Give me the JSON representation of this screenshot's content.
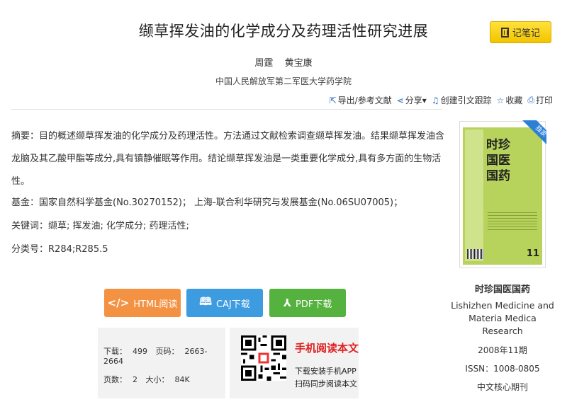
{
  "title": "缬草挥发油的化学成分及药理活性研究进展",
  "note_button": "记笔记",
  "authors": [
    "周霆",
    "黄宝康"
  ],
  "affiliation": "中国人民解放军第二军医大学药学院",
  "tools": [
    {
      "icon": "export-icon",
      "label": "导出/参考文献"
    },
    {
      "icon": "share-icon",
      "label": "分享▾"
    },
    {
      "icon": "bell-icon",
      "label": "创建引文跟踪"
    },
    {
      "icon": "star-icon",
      "label": "收藏"
    },
    {
      "icon": "print-icon",
      "label": "打印"
    }
  ],
  "abstract": {
    "label": "摘要：",
    "text": "目的概述缬草挥发油的化学成分及药理活性。方法通过文献检索调查缬草挥发油。结果缬草挥发油含龙脑及其乙酸甲酯等成分,具有镇静催眠等作用。结论缬草挥发油是一类重要化学成分,具有多方面的生物活性。"
  },
  "fund": {
    "label": "基金：",
    "value": "国家自然科学基金(No.30270152)；  上海-联合利华研究与发展基金(No.06SU07005)；"
  },
  "keywords": {
    "label": "关键词：",
    "value": "缬草; 挥发油; 化学成分; 药理活性;"
  },
  "classification": {
    "label": "分类号：",
    "value": "R284;R285.5"
  },
  "buttons": {
    "html": "HTML阅读",
    "caj": "CAJ下载",
    "pdf": "PDF下载"
  },
  "file_info": {
    "downloads_label": "下载：",
    "downloads": "499",
    "pages_label": "页码：",
    "pages": "2663-2664",
    "page_count_label": "页数：",
    "page_count": "2",
    "size_label": "大小：",
    "size": "84K"
  },
  "mobile": {
    "title": "手机阅读本文",
    "line1": "下载安装手机APP",
    "line2": "扫码同步阅读本文"
  },
  "journal": {
    "ribbon": "独家",
    "cover_title": "时珍国医国药",
    "cover_issue": "11",
    "name": "时珍国医国药",
    "name_en": "Lishizhen Medicine and Materia Medica Research",
    "issue": "2008年11期",
    "issn_label": "ISSN：",
    "issn": "1008-0805",
    "core": "中文核心期刊"
  },
  "colors": {
    "html_button": "#f49243",
    "caj_button": "#3d9be0",
    "pdf_button": "#56b23e",
    "note_button": "#f8d21a",
    "mobile_title": "#e02020",
    "ribbon": "#2b7fd6"
  }
}
